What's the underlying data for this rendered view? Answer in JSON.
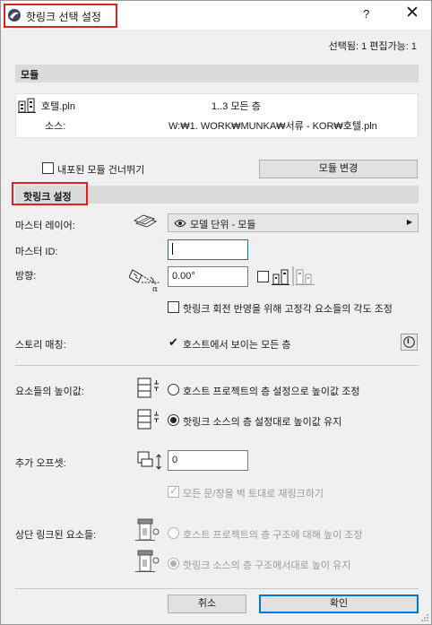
{
  "window": {
    "title": "핫링크 선택 설정",
    "help_label": "?",
    "close_label": "✕"
  },
  "selection_info": "선택됨: 1 편집가능: 1",
  "module_section": {
    "header": "모듈",
    "file_name": "호텔.pln",
    "stories": "1..3 모든 층",
    "source_label": "소스:",
    "source_path": "W:₩1. WORK₩MUNKA₩서류 - KOR₩호텔.pln",
    "skip_nested_label": "내포된 모듈 건너뛰기",
    "skip_nested_checked": false,
    "change_module_button": "모듈 변경"
  },
  "hotlink_settings": {
    "header": "핫링크 설정",
    "master_layer_label": "마스터 레이어:",
    "master_layer_value": "모델 단위 - 모듈",
    "master_id_label": "마스터 ID:",
    "master_id_value": "",
    "orientation_label": "방향:",
    "orientation_value": "0.00°",
    "mirror_checked": false,
    "adjust_angle_label": "핫링크 회전 반영을 위해 고정각 요소들의 각도 조정",
    "adjust_angle_checked": false,
    "story_match_label": "스토리 매칭:",
    "story_match_value": "호스트에서 보이는 모든 층",
    "info_glyph": "i"
  },
  "elevation": {
    "label": "요소들의 높이값:",
    "option_host": "호스트 프로젝트의 층 설정으로 높이값 조정",
    "option_source": "핫링크 소스의 층 설정대로 높이값 유지",
    "selected": "source"
  },
  "offset": {
    "label": "추가 오프셋:",
    "value": "0",
    "rehost_label": "모든 문/창을 벽 토대로 재링크하기",
    "rehost_checked": true
  },
  "top_linked": {
    "label": "상단 링크된 요소들:",
    "option_host": "호스트 프로젝트의 층 구조에 대해 높이 조정",
    "option_source": "핫링크 소스의 층 구조에서대로 높이 유지",
    "selected": "source"
  },
  "footer": {
    "cancel_button": "취소",
    "ok_button": "확인"
  },
  "colors": {
    "highlight": "#e02020",
    "accent": "#0078d7",
    "section_bg": "#dadada",
    "dialog_bg": "#f0f0f0"
  }
}
